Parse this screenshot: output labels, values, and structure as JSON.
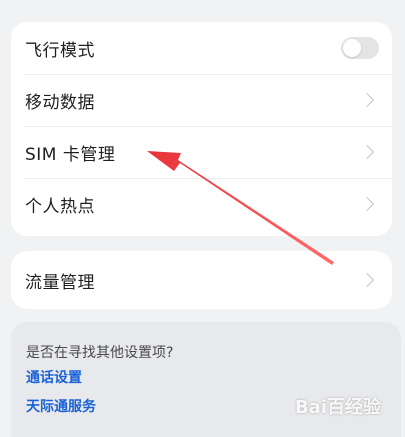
{
  "network": {
    "rows": [
      {
        "label": "飞行模式",
        "control": "toggle",
        "state": "off"
      },
      {
        "label": "移动数据",
        "control": "chevron"
      },
      {
        "label": "SIM 卡管理",
        "control": "chevron"
      },
      {
        "label": "个人热点",
        "control": "chevron"
      }
    ]
  },
  "traffic": {
    "label": "流量管理"
  },
  "search": {
    "title": "是否在寻找其他设置项?",
    "links": [
      "通话设置",
      "天际通服务"
    ]
  },
  "watermark": "Bai百经验",
  "colors": {
    "background": "#f1f2f4",
    "card": "#ffffff",
    "link": "#1a63d6",
    "annotation_arrow": "#e8343a"
  },
  "icons": {
    "chevron": "chevron-right-icon",
    "arrow": "red-annotation-arrow"
  }
}
